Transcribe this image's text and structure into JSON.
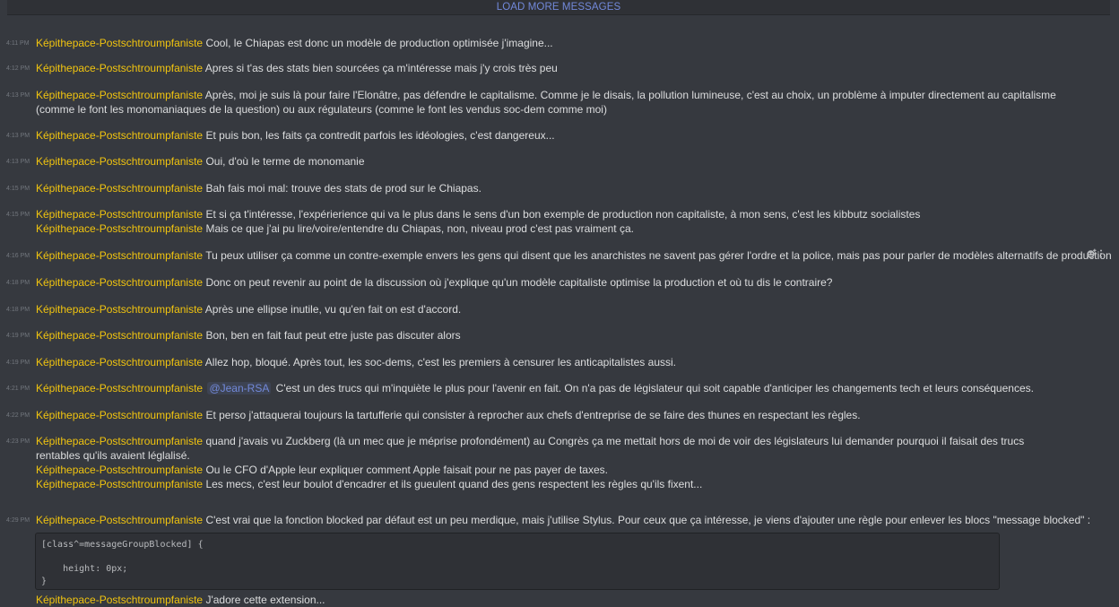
{
  "load_more": "LOAD MORE MESSAGES",
  "author": "Képithepace-Postschtroumpfaniste",
  "messages": [
    {
      "time": "4:11 PM",
      "text": "Cool, le Chiapas est donc un modèle de production optimisée j'imagine..."
    },
    {
      "time": "4:12 PM",
      "text": "Apres si t'as des stats bien sourcées ça m'intéresse mais j'y crois très peu"
    },
    {
      "time": "4:13 PM",
      "text": "Après, moi je suis là pour faire l'Elonâtre, pas défendre le capitalisme. Comme je le disais, la pollution lumineuse, c'est au choix, un problème à imputer directement au capitalisme (comme le font les monomaniaques de la question) ou aux régulateurs (comme le font les vendus soc-dem comme moi)"
    },
    {
      "time": "4:13 PM",
      "text": "Et puis bon, les faits ça contredit parfois les idéologies, c'est dangereux..."
    },
    {
      "time": "4:13 PM",
      "text": "Oui, d'où le terme de monomanie"
    },
    {
      "time": "4:15 PM",
      "text": "Bah fais moi mal: trouve des stats de prod sur le Chiapas."
    },
    {
      "time": "4:15 PM",
      "text": "Et si ça t'intéresse, l'expérierience qui va le plus dans le sens d'un bon exemple de production non capitaliste, à mon sens, c'est les kibbutz socialistes"
    },
    {
      "time": "",
      "text": "Mais ce que j'ai pu lire/voire/entendre du Chiapas, non, niveau prod c'est pas vraiment ça."
    },
    {
      "time": "4:16 PM",
      "text": "Tu peux utiliser ça comme un contre-exemple envers les gens qui disent que les anarchistes ne savent pas gérer l'ordre et la police, mais pas pour parler de modèles alternatifs de production"
    },
    {
      "time": "4:18 PM",
      "text": "Donc on peut revenir au point de la discussion où j'explique qu'un modèle capitaliste optimise la production et où tu dis le contraire?"
    },
    {
      "time": "4:18 PM",
      "text": "Après une ellipse inutile, vu qu'en fait on est d'accord."
    },
    {
      "time": "4:19 PM",
      "text": "Bon, ben en fait faut peut etre juste pas discuter alors"
    },
    {
      "time": "4:19 PM",
      "text": "Allez hop, bloqué. Après tout, les soc-dems, c'est les premiers à censurer les anticapitalistes aussi."
    },
    {
      "time": "4:21 PM",
      "mention": "@Jean-RSA",
      "text": "C'est un des trucs qui m'inquiète le plus pour l'avenir en fait. On n'a pas de législateur qui soit capable d'anticiper les changements tech et leurs conséquences."
    },
    {
      "time": "4:22 PM",
      "text": "Et perso j'attaquerai toujours la tartufferie qui consister à reprocher aux chefs d'entreprise de se faire des thunes en respectant les règles."
    },
    {
      "time": "4:23 PM",
      "text": "quand j'avais vu Zuckberg (là un mec que je méprise profondément) au Congrès ça me mettait hors de moi de voir des législateurs lui demander pourquoi il faisait des trucs rentables qu'ils avaient léglalisé."
    },
    {
      "time": "",
      "text": "Ou le CFO d'Apple leur expliquer comment Apple faisait pour ne pas payer de taxes."
    },
    {
      "time": "",
      "text": "Les mecs, c'est leur boulot d'encadrer et ils gueulent quand des gens respectent les règles qu'ils fixent..."
    },
    {
      "time": "4:29 PM",
      "text": "C'est vrai que la fonction blocked par défaut est un peu merdique, mais j'utilise Stylus. Pour ceux que ça intéresse, je viens d'ajouter une règle pour enlever les blocs \"message blocked\" :"
    },
    {
      "time": "",
      "text": "J'adore cette extension..."
    }
  ],
  "code_lines": [
    "[class^=messageGroupBlocked] {",
    "",
    "    height: 0px;",
    "}"
  ],
  "colors": {
    "author": "#f1c40f",
    "mention": "#7289da",
    "background": "#36393f"
  }
}
